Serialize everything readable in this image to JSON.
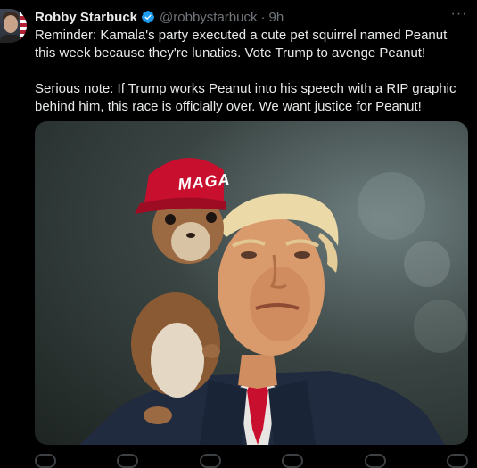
{
  "tweet": {
    "author_name": "Robby Starbuck",
    "handle": "@robbystarbuck",
    "separator": "·",
    "time": "9h",
    "more_label": "···",
    "paragraphs": [
      "Reminder: Kamala's party executed a cute pet squirrel named Peanut this week because they're lunatics. Vote Trump to avenge Peanut!",
      "Serious note: If Trump works Peanut into his speech with a RIP graphic behind him, this race is officially over. We want justice for Peanut!"
    ],
    "media": {
      "hat_text": "MAGA",
      "accent_hat": "#c8102e",
      "accent_tie": "#c8102e"
    },
    "verified_color": "#1d9bf0"
  },
  "icons": [
    "verified-badge-icon",
    "more-icon",
    "reply-icon",
    "repost-icon",
    "like-icon",
    "views-icon",
    "bookmark-icon",
    "share-icon"
  ]
}
